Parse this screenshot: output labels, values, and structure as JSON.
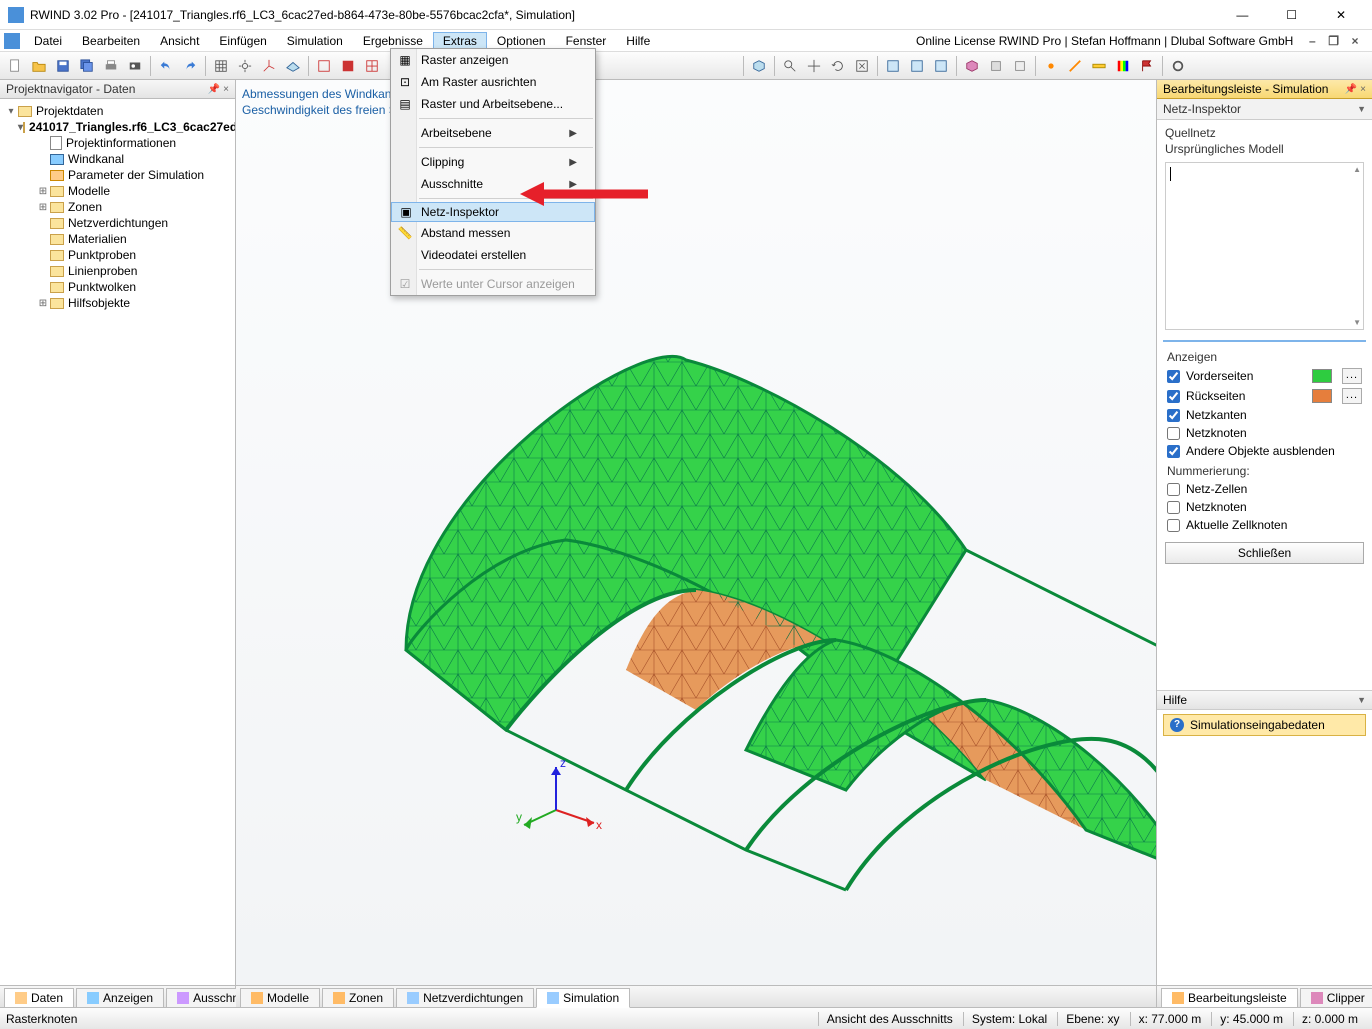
{
  "window": {
    "title": "RWIND 3.02 Pro - [241017_Triangles.rf6_LC3_6cac27ed-b864-473e-80be-5576bcac2cfa*, Simulation]"
  },
  "menubar": {
    "items": [
      "Datei",
      "Bearbeiten",
      "Ansicht",
      "Einfügen",
      "Simulation",
      "Ergebnisse",
      "Extras",
      "Optionen",
      "Fenster",
      "Hilfe"
    ],
    "open_index": 6,
    "license": "Online License RWIND Pro | Stefan Hoffmann | Dlubal Software GmbH"
  },
  "viewport_hint": {
    "line1": "Abmessungen des Windkanals:",
    "line2": "Geschwindigkeit des freien Str"
  },
  "dropdown": {
    "items": [
      {
        "label": "Raster anzeigen",
        "icon": "grid-icon"
      },
      {
        "label": "Am Raster ausrichten",
        "icon": "snap-icon"
      },
      {
        "label": "Raster und Arbeitsebene...",
        "icon": "grid-settings-icon"
      },
      {
        "sep": true
      },
      {
        "label": "Arbeitsebene",
        "submenu": true
      },
      {
        "sep": true
      },
      {
        "label": "Clipping",
        "submenu": true
      },
      {
        "label": "Ausschnitte",
        "submenu": true
      },
      {
        "sep": true
      },
      {
        "label": "Netz-Inspektor",
        "icon": "mesh-inspector-icon",
        "highlight": true
      },
      {
        "label": "Abstand messen",
        "icon": "measure-icon"
      },
      {
        "label": "Videodatei erstellen"
      },
      {
        "sep": true
      },
      {
        "label": "Werte unter Cursor anzeigen",
        "disabled": true,
        "icon": "checkbox-icon"
      }
    ]
  },
  "navigator": {
    "title": "Projektnavigator - Daten",
    "root": "Projektdaten",
    "file": "241017_Triangles.rf6_LC3_6cac27ed",
    "nodes": [
      {
        "label": "Projektinformationen",
        "icon": "page"
      },
      {
        "label": "Windkanal",
        "icon": "wind"
      },
      {
        "label": "Parameter der Simulation",
        "icon": "params"
      },
      {
        "label": "Modelle",
        "icon": "folder",
        "expandable": true
      },
      {
        "label": "Zonen",
        "icon": "folder",
        "expandable": true
      },
      {
        "label": "Netzverdichtungen",
        "icon": "folder"
      },
      {
        "label": "Materialien",
        "icon": "folder"
      },
      {
        "label": "Punktproben",
        "icon": "folder"
      },
      {
        "label": "Linienproben",
        "icon": "folder"
      },
      {
        "label": "Punktwolken",
        "icon": "folder"
      },
      {
        "label": "Hilfsobjekte",
        "icon": "folder",
        "expandable": true
      }
    ],
    "bottom_tabs": [
      "Daten",
      "Anzeigen",
      "Ausschnitte"
    ],
    "bottom_active": 0
  },
  "center_tabs": {
    "items": [
      "Modelle",
      "Zonen",
      "Netzverdichtungen",
      "Simulation"
    ],
    "active": 3
  },
  "right_tabs": {
    "items": [
      "Bearbeitungsleiste",
      "Clipper"
    ],
    "active": 0
  },
  "rightpanel": {
    "title": "Bearbeitungsleiste - Simulation",
    "subtitle": "Netz-Inspektor",
    "source_label": "Quellnetz",
    "source_value": "Ursprüngliches Modell",
    "display_section": "Anzeigen",
    "checks": {
      "front": {
        "label": "Vorderseiten",
        "checked": true,
        "color": "#2ecc40"
      },
      "back": {
        "label": "Rückseiten",
        "checked": true,
        "color": "#e67e3c"
      },
      "edges": {
        "label": "Netzkanten",
        "checked": true
      },
      "nodes": {
        "label": "Netzknoten",
        "checked": false
      },
      "hide": {
        "label": "Andere Objekte ausblenden",
        "checked": true
      }
    },
    "numbering_section": "Nummerierung:",
    "num_checks": {
      "cells": {
        "label": "Netz-Zellen",
        "checked": false
      },
      "nnodes": {
        "label": "Netzknoten",
        "checked": false
      },
      "cellnodes": {
        "label": "Aktuelle Zellknoten",
        "checked": false
      }
    },
    "close": "Schließen",
    "help_header": "Hilfe",
    "help_item": "Simulationseingabedaten"
  },
  "statusbar": {
    "left": "Rasterknoten",
    "cells": [
      "Ansicht des Ausschnitts",
      "System: Lokal",
      "Ebene: xy",
      "x: 77.000 m",
      "y: 45.000 m",
      "z: 0.000 m"
    ]
  },
  "axis": {
    "x": "x",
    "y": "y",
    "z": "z"
  }
}
